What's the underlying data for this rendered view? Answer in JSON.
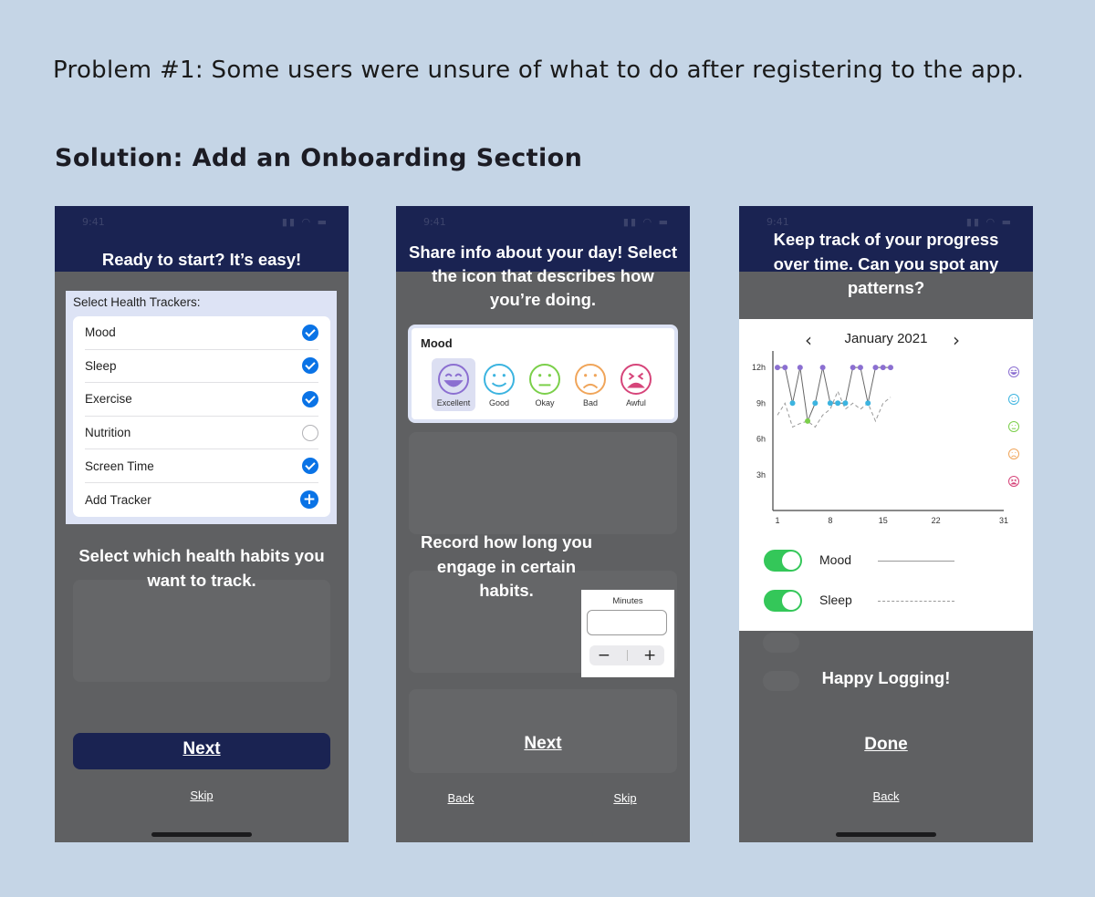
{
  "header": {
    "problem": "Problem #1: Some users were unsure of what to do after registering to the app.",
    "solution": "Solution: Add an Onboarding Section"
  },
  "phone1": {
    "status_time": "9:41",
    "overlay_title": "Ready to start? It’s easy!",
    "card_title": "Select Health Trackers:",
    "trackers": [
      {
        "label": "Mood",
        "checked": true
      },
      {
        "label": "Sleep",
        "checked": true
      },
      {
        "label": "Exercise",
        "checked": true
      },
      {
        "label": "Nutrition",
        "checked": false
      },
      {
        "label": "Screen Time",
        "checked": true
      },
      {
        "label": "Add Tracker"
      }
    ],
    "overlay_caption": "Select which health habits you want to track.",
    "next_label": "Next",
    "skip_label": "Skip"
  },
  "phone2": {
    "status_time": "9:41",
    "overlay_title": "Share info about your day! Select the icon that describes how you’re doing.",
    "mood_title": "Mood",
    "moods": [
      {
        "label": "Excellent",
        "color": "#8b6fd1",
        "selected": true
      },
      {
        "label": "Good",
        "color": "#3cb4e0"
      },
      {
        "label": "Okay",
        "color": "#7bcf4a"
      },
      {
        "label": "Bad",
        "color": "#f0a55a"
      },
      {
        "label": "Awful",
        "color": "#d6457a"
      }
    ],
    "overlay_caption": "Record how long you engage in certain habits.",
    "minutes_label": "Minutes",
    "minus_label": "−",
    "plus_label": "+",
    "next_label": "Next",
    "back_label": "Back",
    "skip_label": "Skip"
  },
  "phone3": {
    "status_time": "9:41",
    "overlay_title": "Keep track of your progress over time. Can you spot any patterns?",
    "month": "January 2021",
    "toggles": [
      {
        "label": "Mood",
        "on": true,
        "line": "solid"
      },
      {
        "label": "Sleep",
        "on": true,
        "line": "dashed"
      }
    ],
    "overlay_caption": "Happy Logging!",
    "done_label": "Done",
    "back_label": "Back"
  },
  "chart_data": {
    "type": "line",
    "title": "",
    "xlabel": "",
    "ylabel": "",
    "x_ticks": [
      "1",
      "8",
      "15",
      "22",
      "31"
    ],
    "y_ticks": [
      "3h",
      "6h",
      "9h",
      "12h"
    ],
    "xlim": [
      1,
      31
    ],
    "ylim": [
      0,
      13
    ],
    "grid": false,
    "legend": "right mood faces",
    "series": [
      {
        "name": "Mood",
        "style": "solid",
        "x": [
          1,
          2,
          3,
          4,
          5,
          6,
          7,
          8,
          9,
          10,
          11,
          12,
          13,
          14,
          15,
          16
        ],
        "y": [
          12,
          12,
          9,
          12,
          7.5,
          9,
          12,
          9,
          9,
          9,
          12,
          12,
          9,
          12,
          12,
          12
        ],
        "mood": [
          "Excellent",
          "Excellent",
          "Good",
          "Excellent",
          "Okay",
          "Good",
          "Excellent",
          "Good",
          "Good",
          "Good",
          "Excellent",
          "Excellent",
          "Good",
          "Excellent",
          "Excellent",
          "Excellent"
        ]
      },
      {
        "name": "Sleep",
        "style": "dashed",
        "x": [
          1,
          2,
          3,
          4,
          5,
          6,
          7,
          8,
          9,
          10,
          11,
          12,
          13,
          14,
          15,
          16
        ],
        "y": [
          8,
          9,
          7,
          7.3,
          7.5,
          7,
          8,
          8.5,
          10,
          8.5,
          9,
          8.5,
          9,
          7.5,
          9,
          9.5
        ]
      }
    ],
    "mood_colors": {
      "Excellent": "#8b6fd1",
      "Good": "#3cb4e0",
      "Okay": "#7bcf4a",
      "Bad": "#f0a55a",
      "Awful": "#d6457a"
    },
    "legend_moods": [
      "Excellent",
      "Good",
      "Okay",
      "Bad",
      "Awful"
    ]
  }
}
